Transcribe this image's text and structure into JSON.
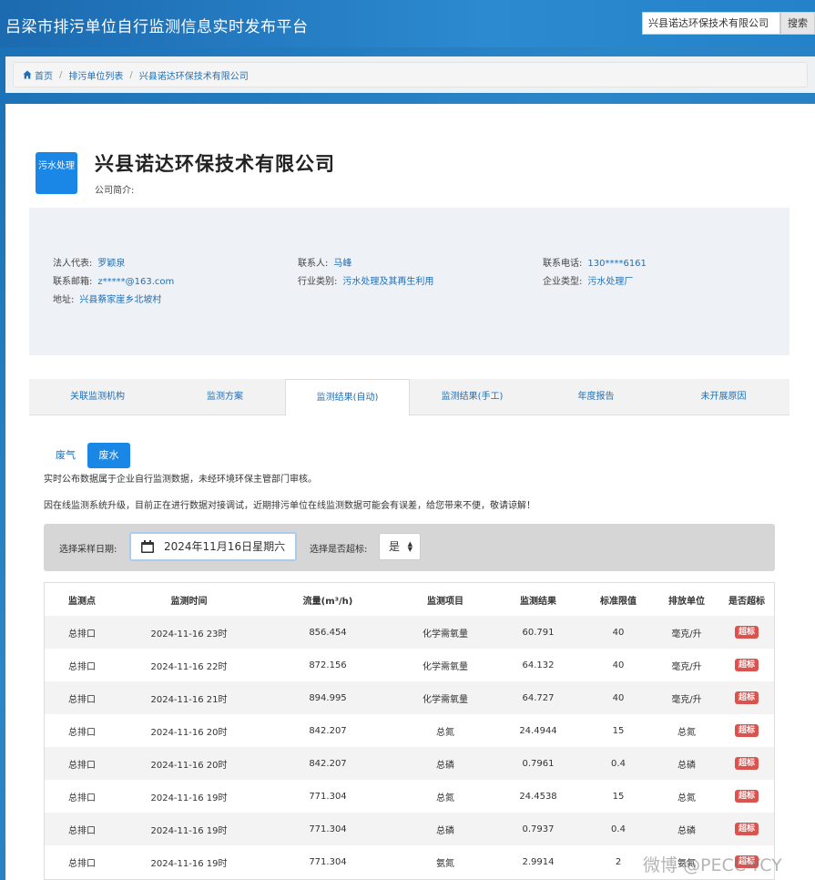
{
  "header": {
    "site_title": "吕梁市排污单位自行监测信息实时发布平台",
    "search_value": "兴县诺达环保技术有限公司",
    "search_button": "搜索"
  },
  "breadcrumb": {
    "home": "首页",
    "list": "排污单位列表",
    "current": "兴县诺达环保技术有限公司"
  },
  "company": {
    "badge": "污水处理",
    "name": "兴县诺达环保技术有限公司",
    "intro_label": "公司简介:",
    "info": {
      "legal_rep_label": "法人代表:",
      "legal_rep": "罗颖泉",
      "contact_label": "联系人:",
      "contact": "马峰",
      "phone_label": "联系电话:",
      "phone": "130****6161",
      "email_label": "联系邮箱:",
      "email": "z*****@163.com",
      "industry_label": "行业类别:",
      "industry": "污水处理及其再生利用",
      "type_label": "企业类型:",
      "type": "污水处理厂",
      "address_label": "地址:",
      "address": "兴县蔡家崖乡北坡村"
    }
  },
  "tabs": {
    "t1": "关联监测机构",
    "t2": "监测方案",
    "t3": "监测结果(自动)",
    "t4": "监测结果(手工)",
    "t5": "年度报告",
    "t6": "未开展原因"
  },
  "sub_tabs": {
    "gas": "废气",
    "water": "废水"
  },
  "notices": {
    "n1": "实时公布数据属于企业自行监测数据，未经环境环保主管部门审核。",
    "n2": "因在线监测系统升级，目前正在进行数据对接调试，近期排污单位在线监测数据可能会有误差，给您带来不便，敬请谅解！"
  },
  "filter": {
    "date_label": "选择采样日期:",
    "date_value": "2024年11月16日星期六",
    "exceed_label": "选择是否超标:",
    "exceed_value": "是"
  },
  "table": {
    "headers": {
      "point": "监测点",
      "time": "监测时间",
      "flow": "流量(m³/h)",
      "item": "监测项目",
      "result": "监测结果",
      "limit": "标准限值",
      "unit": "排放单位",
      "exceed": "是否超标"
    },
    "rows": [
      [
        "总排口",
        "2024-11-16 23时",
        "856.454",
        "化学需氧量",
        "60.791",
        "40",
        "毫克/升",
        "超标"
      ],
      [
        "总排口",
        "2024-11-16 22时",
        "872.156",
        "化学需氧量",
        "64.132",
        "40",
        "毫克/升",
        "超标"
      ],
      [
        "总排口",
        "2024-11-16 21时",
        "894.995",
        "化学需氧量",
        "64.727",
        "40",
        "毫克/升",
        "超标"
      ],
      [
        "总排口",
        "2024-11-16 20时",
        "842.207",
        "总氮",
        "24.4944",
        "15",
        "总氮",
        "超标"
      ],
      [
        "总排口",
        "2024-11-16 20时",
        "842.207",
        "总磷",
        "0.7961",
        "0.4",
        "总磷",
        "超标"
      ],
      [
        "总排口",
        "2024-11-16 19时",
        "771.304",
        "总氮",
        "24.4538",
        "15",
        "总氮",
        "超标"
      ],
      [
        "总排口",
        "2024-11-16 19时",
        "771.304",
        "总磷",
        "0.7937",
        "0.4",
        "总磷",
        "超标"
      ],
      [
        "总排口",
        "2024-11-16 19时",
        "771.304",
        "氨氮",
        "2.9914",
        "2",
        "氨氮",
        "超标"
      ]
    ]
  },
  "watermark": "微博 @PECC-YCY",
  "colors": {
    "accent": "#1a86e6",
    "link": "#1f6fb8",
    "danger": "#d9534f"
  }
}
